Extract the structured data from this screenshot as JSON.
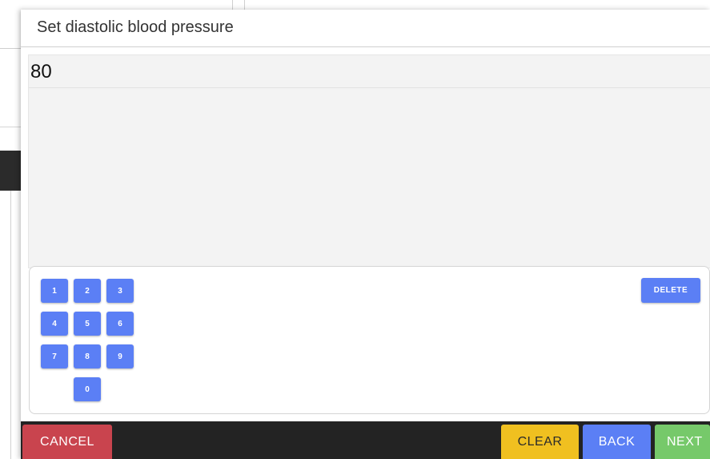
{
  "modal": {
    "title": "Set diastolic blood pressure",
    "value": "80"
  },
  "keypad": {
    "keys": [
      "1",
      "2",
      "3",
      "4",
      "5",
      "6",
      "7",
      "8",
      "9",
      "0"
    ],
    "delete_label": "DELETE"
  },
  "footer": {
    "cancel_label": "CANCEL",
    "clear_label": "CLEAR",
    "back_label": "BACK",
    "next_label": "NEXT"
  },
  "colors": {
    "key_blue": "#5b7ff5",
    "cancel_red": "#c9444e",
    "clear_yellow": "#f0c020",
    "next_green": "#76c96a",
    "footer_dark": "#232323"
  }
}
